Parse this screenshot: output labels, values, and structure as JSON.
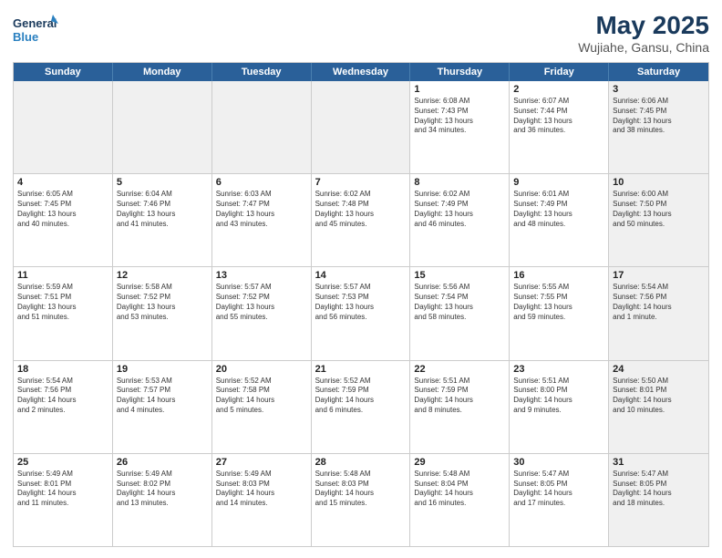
{
  "logo": {
    "line1": "General",
    "line2": "Blue"
  },
  "title": "May 2025",
  "subtitle": "Wujiahe, Gansu, China",
  "header_days": [
    "Sunday",
    "Monday",
    "Tuesday",
    "Wednesday",
    "Thursday",
    "Friday",
    "Saturday"
  ],
  "weeks": [
    [
      {
        "day": "",
        "text": "",
        "shaded": true
      },
      {
        "day": "",
        "text": "",
        "shaded": true
      },
      {
        "day": "",
        "text": "",
        "shaded": true
      },
      {
        "day": "",
        "text": "",
        "shaded": true
      },
      {
        "day": "1",
        "text": "Sunrise: 6:08 AM\nSunset: 7:43 PM\nDaylight: 13 hours\nand 34 minutes.",
        "shaded": false
      },
      {
        "day": "2",
        "text": "Sunrise: 6:07 AM\nSunset: 7:44 PM\nDaylight: 13 hours\nand 36 minutes.",
        "shaded": false
      },
      {
        "day": "3",
        "text": "Sunrise: 6:06 AM\nSunset: 7:45 PM\nDaylight: 13 hours\nand 38 minutes.",
        "shaded": true
      }
    ],
    [
      {
        "day": "4",
        "text": "Sunrise: 6:05 AM\nSunset: 7:45 PM\nDaylight: 13 hours\nand 40 minutes.",
        "shaded": false
      },
      {
        "day": "5",
        "text": "Sunrise: 6:04 AM\nSunset: 7:46 PM\nDaylight: 13 hours\nand 41 minutes.",
        "shaded": false
      },
      {
        "day": "6",
        "text": "Sunrise: 6:03 AM\nSunset: 7:47 PM\nDaylight: 13 hours\nand 43 minutes.",
        "shaded": false
      },
      {
        "day": "7",
        "text": "Sunrise: 6:02 AM\nSunset: 7:48 PM\nDaylight: 13 hours\nand 45 minutes.",
        "shaded": false
      },
      {
        "day": "8",
        "text": "Sunrise: 6:02 AM\nSunset: 7:49 PM\nDaylight: 13 hours\nand 46 minutes.",
        "shaded": false
      },
      {
        "day": "9",
        "text": "Sunrise: 6:01 AM\nSunset: 7:49 PM\nDaylight: 13 hours\nand 48 minutes.",
        "shaded": false
      },
      {
        "day": "10",
        "text": "Sunrise: 6:00 AM\nSunset: 7:50 PM\nDaylight: 13 hours\nand 50 minutes.",
        "shaded": true
      }
    ],
    [
      {
        "day": "11",
        "text": "Sunrise: 5:59 AM\nSunset: 7:51 PM\nDaylight: 13 hours\nand 51 minutes.",
        "shaded": false
      },
      {
        "day": "12",
        "text": "Sunrise: 5:58 AM\nSunset: 7:52 PM\nDaylight: 13 hours\nand 53 minutes.",
        "shaded": false
      },
      {
        "day": "13",
        "text": "Sunrise: 5:57 AM\nSunset: 7:52 PM\nDaylight: 13 hours\nand 55 minutes.",
        "shaded": false
      },
      {
        "day": "14",
        "text": "Sunrise: 5:57 AM\nSunset: 7:53 PM\nDaylight: 13 hours\nand 56 minutes.",
        "shaded": false
      },
      {
        "day": "15",
        "text": "Sunrise: 5:56 AM\nSunset: 7:54 PM\nDaylight: 13 hours\nand 58 minutes.",
        "shaded": false
      },
      {
        "day": "16",
        "text": "Sunrise: 5:55 AM\nSunset: 7:55 PM\nDaylight: 13 hours\nand 59 minutes.",
        "shaded": false
      },
      {
        "day": "17",
        "text": "Sunrise: 5:54 AM\nSunset: 7:56 PM\nDaylight: 14 hours\nand 1 minute.",
        "shaded": true
      }
    ],
    [
      {
        "day": "18",
        "text": "Sunrise: 5:54 AM\nSunset: 7:56 PM\nDaylight: 14 hours\nand 2 minutes.",
        "shaded": false
      },
      {
        "day": "19",
        "text": "Sunrise: 5:53 AM\nSunset: 7:57 PM\nDaylight: 14 hours\nand 4 minutes.",
        "shaded": false
      },
      {
        "day": "20",
        "text": "Sunrise: 5:52 AM\nSunset: 7:58 PM\nDaylight: 14 hours\nand 5 minutes.",
        "shaded": false
      },
      {
        "day": "21",
        "text": "Sunrise: 5:52 AM\nSunset: 7:59 PM\nDaylight: 14 hours\nand 6 minutes.",
        "shaded": false
      },
      {
        "day": "22",
        "text": "Sunrise: 5:51 AM\nSunset: 7:59 PM\nDaylight: 14 hours\nand 8 minutes.",
        "shaded": false
      },
      {
        "day": "23",
        "text": "Sunrise: 5:51 AM\nSunset: 8:00 PM\nDaylight: 14 hours\nand 9 minutes.",
        "shaded": false
      },
      {
        "day": "24",
        "text": "Sunrise: 5:50 AM\nSunset: 8:01 PM\nDaylight: 14 hours\nand 10 minutes.",
        "shaded": true
      }
    ],
    [
      {
        "day": "25",
        "text": "Sunrise: 5:49 AM\nSunset: 8:01 PM\nDaylight: 14 hours\nand 11 minutes.",
        "shaded": false
      },
      {
        "day": "26",
        "text": "Sunrise: 5:49 AM\nSunset: 8:02 PM\nDaylight: 14 hours\nand 13 minutes.",
        "shaded": false
      },
      {
        "day": "27",
        "text": "Sunrise: 5:49 AM\nSunset: 8:03 PM\nDaylight: 14 hours\nand 14 minutes.",
        "shaded": false
      },
      {
        "day": "28",
        "text": "Sunrise: 5:48 AM\nSunset: 8:03 PM\nDaylight: 14 hours\nand 15 minutes.",
        "shaded": false
      },
      {
        "day": "29",
        "text": "Sunrise: 5:48 AM\nSunset: 8:04 PM\nDaylight: 14 hours\nand 16 minutes.",
        "shaded": false
      },
      {
        "day": "30",
        "text": "Sunrise: 5:47 AM\nSunset: 8:05 PM\nDaylight: 14 hours\nand 17 minutes.",
        "shaded": false
      },
      {
        "day": "31",
        "text": "Sunrise: 5:47 AM\nSunset: 8:05 PM\nDaylight: 14 hours\nand 18 minutes.",
        "shaded": true
      }
    ]
  ]
}
